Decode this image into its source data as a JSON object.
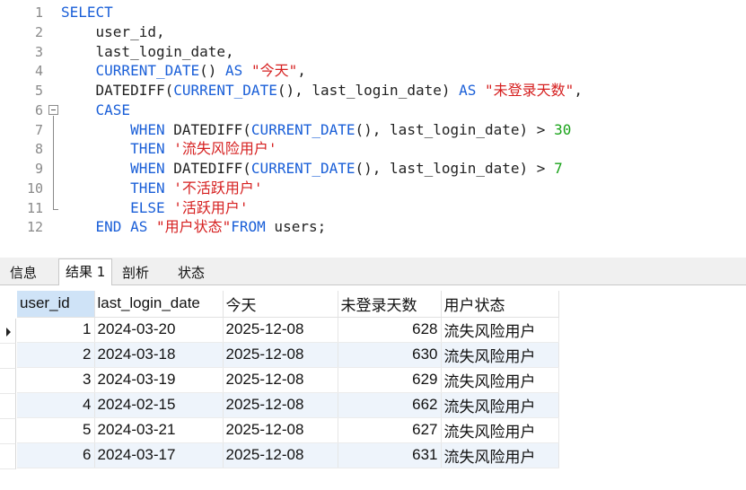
{
  "editor": {
    "line_numbers": [
      "1",
      "2",
      "3",
      "4",
      "5",
      "6",
      "7",
      "8",
      "9",
      "10",
      "11",
      "12"
    ],
    "lines": [
      [
        {
          "t": "SELECT",
          "c": "kw"
        }
      ],
      [
        {
          "t": "    user_id,",
          "c": "id"
        }
      ],
      [
        {
          "t": "    last_login_date,",
          "c": "id"
        }
      ],
      [
        {
          "t": "    ",
          "c": "id"
        },
        {
          "t": "CURRENT_DATE",
          "c": "kw"
        },
        {
          "t": "() ",
          "c": "id"
        },
        {
          "t": "AS",
          "c": "kw"
        },
        {
          "t": " ",
          "c": "id"
        },
        {
          "t": "\"今天\"",
          "c": "str"
        },
        {
          "t": ",",
          "c": "id"
        }
      ],
      [
        {
          "t": "    DATEDIFF(",
          "c": "id"
        },
        {
          "t": "CURRENT_DATE",
          "c": "kw"
        },
        {
          "t": "(), last_login_date) ",
          "c": "id"
        },
        {
          "t": "AS",
          "c": "kw"
        },
        {
          "t": " ",
          "c": "id"
        },
        {
          "t": "\"未登录天数\"",
          "c": "str"
        },
        {
          "t": ",",
          "c": "id"
        }
      ],
      [
        {
          "t": "    ",
          "c": "id"
        },
        {
          "t": "CASE",
          "c": "kw"
        }
      ],
      [
        {
          "t": "        ",
          "c": "id"
        },
        {
          "t": "WHEN",
          "c": "kw"
        },
        {
          "t": " DATEDIFF(",
          "c": "id"
        },
        {
          "t": "CURRENT_DATE",
          "c": "kw"
        },
        {
          "t": "(), last_login_date) > ",
          "c": "id"
        },
        {
          "t": "30",
          "c": "num"
        }
      ],
      [
        {
          "t": "        ",
          "c": "id"
        },
        {
          "t": "THEN",
          "c": "kw"
        },
        {
          "t": " ",
          "c": "id"
        },
        {
          "t": "'流失风险用户'",
          "c": "str"
        }
      ],
      [
        {
          "t": "        ",
          "c": "id"
        },
        {
          "t": "WHEN",
          "c": "kw"
        },
        {
          "t": " DATEDIFF(",
          "c": "id"
        },
        {
          "t": "CURRENT_DATE",
          "c": "kw"
        },
        {
          "t": "(), last_login_date) > ",
          "c": "id"
        },
        {
          "t": "7",
          "c": "num"
        }
      ],
      [
        {
          "t": "        ",
          "c": "id"
        },
        {
          "t": "THEN",
          "c": "kw"
        },
        {
          "t": " ",
          "c": "id"
        },
        {
          "t": "'不活跃用户'",
          "c": "str"
        }
      ],
      [
        {
          "t": "        ",
          "c": "id"
        },
        {
          "t": "ELSE",
          "c": "kw"
        },
        {
          "t": " ",
          "c": "id"
        },
        {
          "t": "'活跃用户'",
          "c": "str"
        }
      ],
      [
        {
          "t": "    ",
          "c": "id"
        },
        {
          "t": "END",
          "c": "kw"
        },
        {
          "t": " ",
          "c": "id"
        },
        {
          "t": "AS",
          "c": "kw"
        },
        {
          "t": " ",
          "c": "id"
        },
        {
          "t": "\"用户状态\"",
          "c": "str"
        },
        {
          "t": "FROM",
          "c": "kw"
        },
        {
          "t": " users;",
          "c": "id"
        }
      ]
    ],
    "colors": {
      "keyword": "#1a5fd8",
      "string": "#d62020",
      "number": "#1aa31a",
      "text": "#222222"
    }
  },
  "tabs": [
    {
      "label": "信息",
      "active": false
    },
    {
      "label": "结果 1",
      "active": true
    },
    {
      "label": "剖析",
      "active": false
    },
    {
      "label": "状态",
      "active": false
    }
  ],
  "results": {
    "columns": [
      "user_id",
      "last_login_date",
      "今天",
      "未登录天数",
      "用户状态"
    ],
    "rows": [
      [
        "1",
        "2024-03-20",
        "2025-12-08",
        "628",
        "流失风险用户"
      ],
      [
        "2",
        "2024-03-18",
        "2025-12-08",
        "630",
        "流失风险用户"
      ],
      [
        "3",
        "2024-03-19",
        "2025-12-08",
        "629",
        "流失风险用户"
      ],
      [
        "4",
        "2024-02-15",
        "2025-12-08",
        "662",
        "流失风险用户"
      ],
      [
        "5",
        "2024-03-21",
        "2025-12-08",
        "627",
        "流失风险用户"
      ],
      [
        "6",
        "2024-03-17",
        "2025-12-08",
        "631",
        "流失风险用户"
      ]
    ],
    "current_row_icon": "row-pointer-icon",
    "selected_header_color": "#cfe3f7",
    "alt_row_color": "#eef4fb"
  }
}
